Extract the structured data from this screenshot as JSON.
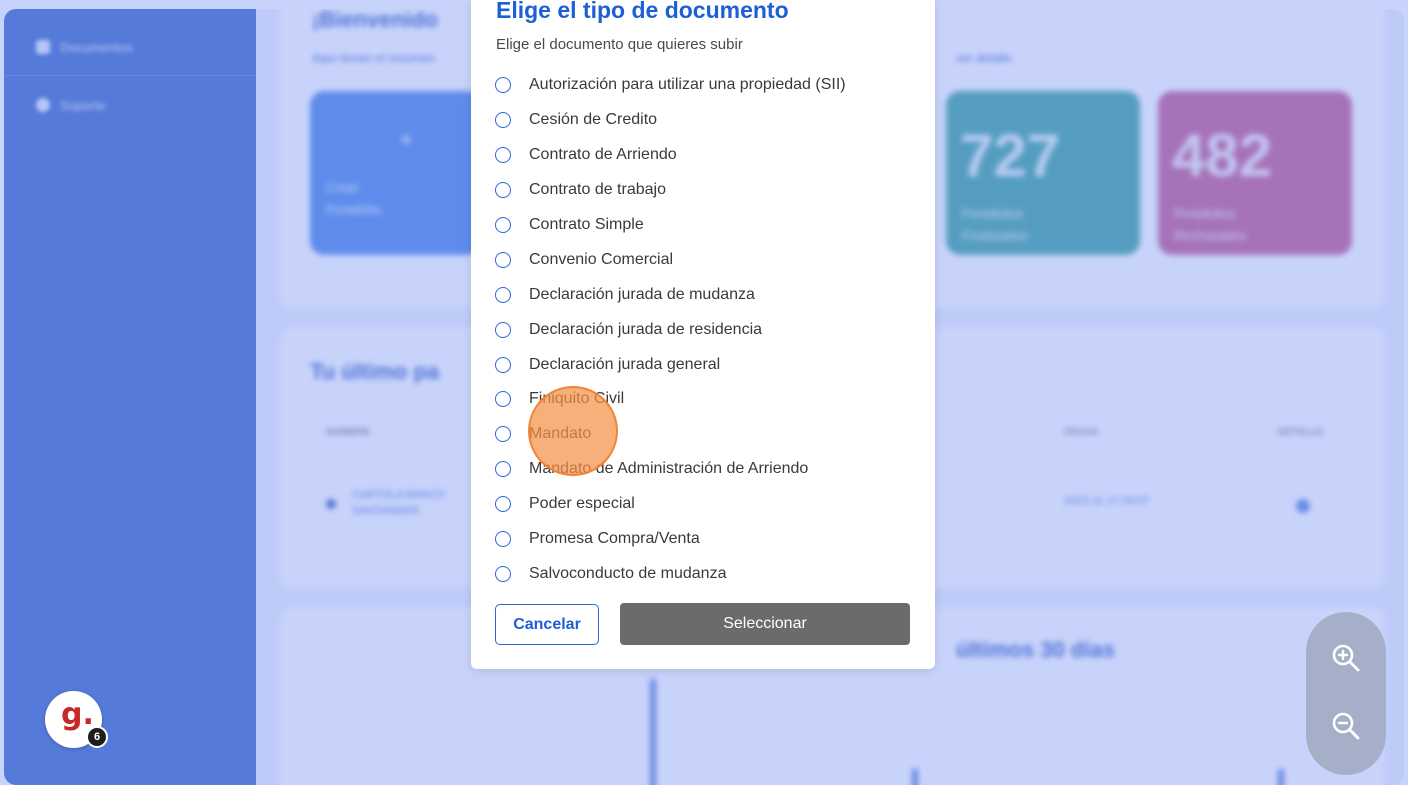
{
  "sidebar": {
    "items": [
      {
        "label": "Documentos",
        "icon": "document-icon"
      },
      {
        "label": "Soporte",
        "icon": "support-icon"
      }
    ]
  },
  "background": {
    "header_title": "¡Bienvenido",
    "header_subtitle": "Aquí tienes el resumen",
    "header_link_right": "ver detalle",
    "create_card": {
      "plus": "+",
      "label": "Crear Portafolio"
    },
    "stat_cards": [
      {
        "value": "727",
        "label": "Portafolios Finalizados",
        "color": "#3aa39a"
      },
      {
        "value": "482",
        "label": "Portafolios Rechazados",
        "color": "#c45a8e"
      }
    ],
    "last_section_title": "Tu último pa",
    "table_headers": [
      "NOMBRE",
      "FECHA",
      "DETALLE"
    ],
    "table_row": {
      "name": "CARTOLA BANCO SANTANDER",
      "date": "2023-11 17:33:07"
    },
    "chart_title": "últimos 30 días"
  },
  "modal": {
    "title": "Elige el tipo de documento",
    "subtitle": "Elige el documento que quieres subir",
    "options": [
      "Autorización para utilizar una propiedad (SII)",
      "Cesión de Credito",
      "Contrato de Arriendo",
      "Contrato de trabajo",
      "Contrato Simple",
      "Convenio Comercial",
      "Declaración jurada de mudanza",
      "Declaración jurada de residencia",
      "Declaración jurada general",
      "Finiquito Civil",
      "Mandato",
      "Mandato de Administración de Arriendo",
      "Poder especial",
      "Promesa Compra/Venta",
      "Salvoconducto de mudanza"
    ],
    "cancel_label": "Cancelar",
    "select_label": "Seleccionar"
  },
  "zoom": {
    "in_icon": "zoom-in-icon",
    "out_icon": "zoom-out-icon"
  },
  "logo": {
    "mark": "g.",
    "badge_count": "6"
  },
  "colors": {
    "accent": "#1d5fd6",
    "sidebar": "#3a66c4",
    "overlay": "#7d96f5",
    "click_marker": "#f59247",
    "select_button": "#6b6b6b"
  }
}
